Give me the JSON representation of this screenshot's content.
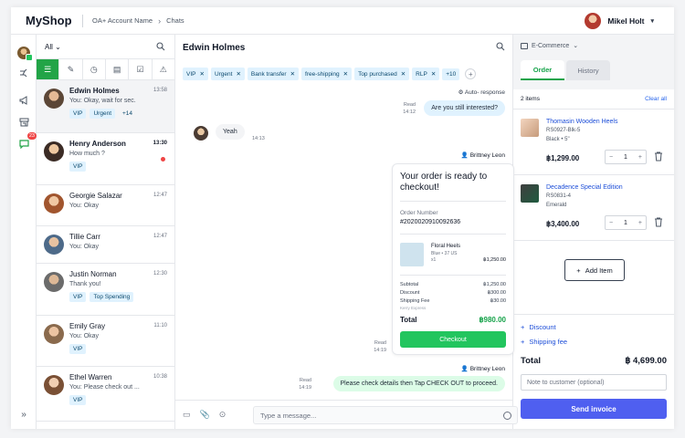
{
  "app": {
    "logo": "MyShop"
  },
  "breadcrumb": {
    "account": "OA+ Account Name",
    "page": "Chats"
  },
  "user": {
    "name": "Mikel Holt"
  },
  "rail": {
    "badge_count": "23"
  },
  "list": {
    "filter_label": "All",
    "chats": [
      {
        "name": "Edwin Holmes",
        "preview": "You: Okay, wait for sec.",
        "time": "13:58",
        "tags": [
          "VIP",
          "Urgent"
        ],
        "more": "+14"
      },
      {
        "name": "Henry Anderson",
        "preview": "How much ?",
        "time": "13:30",
        "tags": [
          "VIP"
        ]
      },
      {
        "name": "Georgie Salazar",
        "preview": "You: Okay",
        "time": "12:47"
      },
      {
        "name": "Tillie Carr",
        "preview": "You: Okay",
        "time": "12:47"
      },
      {
        "name": "Justin Norman",
        "preview": "Thank you!",
        "time": "12:30",
        "tags": [
          "VIP",
          "Top Spending"
        ]
      },
      {
        "name": "Emily Gray",
        "preview": "You: Okay",
        "time": "11:10",
        "tags": [
          "VIP"
        ]
      },
      {
        "name": "Ethel Warren",
        "preview": "You: Please check out ...",
        "time": "10:38",
        "tags": [
          "VIP"
        ]
      }
    ]
  },
  "conversation": {
    "title": "Edwin Holmes",
    "tags": [
      "VIP",
      "Urgent",
      "Bank transfer",
      "free-shipping",
      "Top purchased",
      "RLP"
    ],
    "tags_more": "+10",
    "auto_response": "Auto- response",
    "msg1": {
      "text": "Are you still interested?",
      "status": "Read",
      "time": "14:12"
    },
    "msg2": {
      "text": "Yeah",
      "time": "14:13"
    },
    "agent": "Brittney Leon",
    "card": {
      "title": "Your order is ready to checkout!",
      "order_label": "Order Number",
      "order_number": "#2020020910092636",
      "product_name": "Floral Heels",
      "product_variant": "Blue • 37 US",
      "product_qty": "x1",
      "product_price": "฿1,250.00",
      "subtotal_label": "Subtotal",
      "subtotal": "฿1,250.00",
      "discount_label": "Discount",
      "discount": "฿300.00",
      "shipping_label": "Shipping Fee",
      "shipping": "฿30.00",
      "shipping_note": "Kerry Express",
      "total_label": "Total",
      "total": "฿980.00",
      "checkout_label": "Checkout",
      "status": "Read",
      "time": "14:19"
    },
    "msg3": {
      "text": "Please check details then Tap CHECK OUT to proceed.",
      "status": "Read",
      "time": "14:19"
    },
    "composer_placeholder": "Type a message..."
  },
  "side": {
    "channel": "E-Commerce",
    "tabs": [
      "Order",
      "History"
    ],
    "items_count": "2 items",
    "clear_all": "Clear all",
    "items": [
      {
        "name": "Thomasin Wooden Heels",
        "sku": "RS0927-Blk-5",
        "variant": "Black • 5\"",
        "price": "฿1,299.00",
        "qty": "1"
      },
      {
        "name": "Decadence Special Edition",
        "sku": "RS0831-4",
        "variant": "Emerald",
        "price": "฿3,400.00",
        "qty": "1"
      }
    ],
    "add_item": "Add Item",
    "discount_link": "Discount",
    "shipping_link": "Shipping fee",
    "total_label": "Total",
    "total": "฿ 4,699.00",
    "note_placeholder": "Note to customer (optional)",
    "send_label": "Send invoice"
  }
}
